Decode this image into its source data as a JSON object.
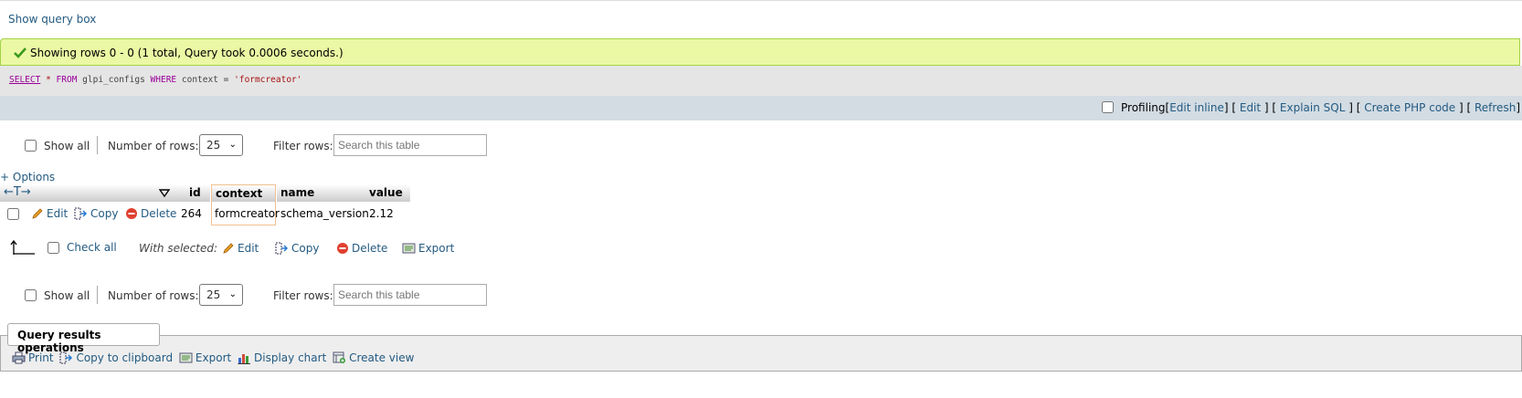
{
  "query_toggle": "Show query box",
  "success_message": "Showing rows 0 - 0 (1 total, Query took 0.0006 seconds.)",
  "sql": {
    "select": "SELECT",
    "star": "*",
    "from": "FROM",
    "table": "glpi_configs",
    "where": "WHERE",
    "column": "context",
    "op": "=",
    "value": "'formcreator'"
  },
  "profiling_bar": {
    "profiling": "Profiling",
    "links": [
      "Edit inline",
      "Edit",
      "Explain SQL",
      "Create PHP code",
      "Refresh"
    ]
  },
  "nav": {
    "show_all": "Show all",
    "number_of_rows": "Number of rows:",
    "rows_value": "25",
    "filter_rows": "Filter rows:",
    "search_placeholder": "Search this table"
  },
  "options_link": "+ Options",
  "sort_arrows": "←T→",
  "table": {
    "columns": [
      "id",
      "context",
      "name",
      "value"
    ],
    "rows": [
      {
        "id": "264",
        "context": "formcreator",
        "name": "schema_version",
        "value": "2.12"
      }
    ],
    "row_actions": {
      "edit": "Edit",
      "copy": "Copy",
      "delete": "Delete"
    }
  },
  "bulk": {
    "check_all": "Check all",
    "with_selected": "With selected:",
    "edit": "Edit",
    "copy": "Copy",
    "delete": "Delete",
    "export": "Export"
  },
  "operations": {
    "legend": "Query results operations",
    "items": [
      "Print",
      "Copy to clipboard",
      "Export",
      "Display chart",
      "Create view"
    ]
  },
  "colors": {
    "link": "#235a81",
    "success_bg": "#ebf8a4",
    "profiling_bg": "#d3dce3"
  }
}
